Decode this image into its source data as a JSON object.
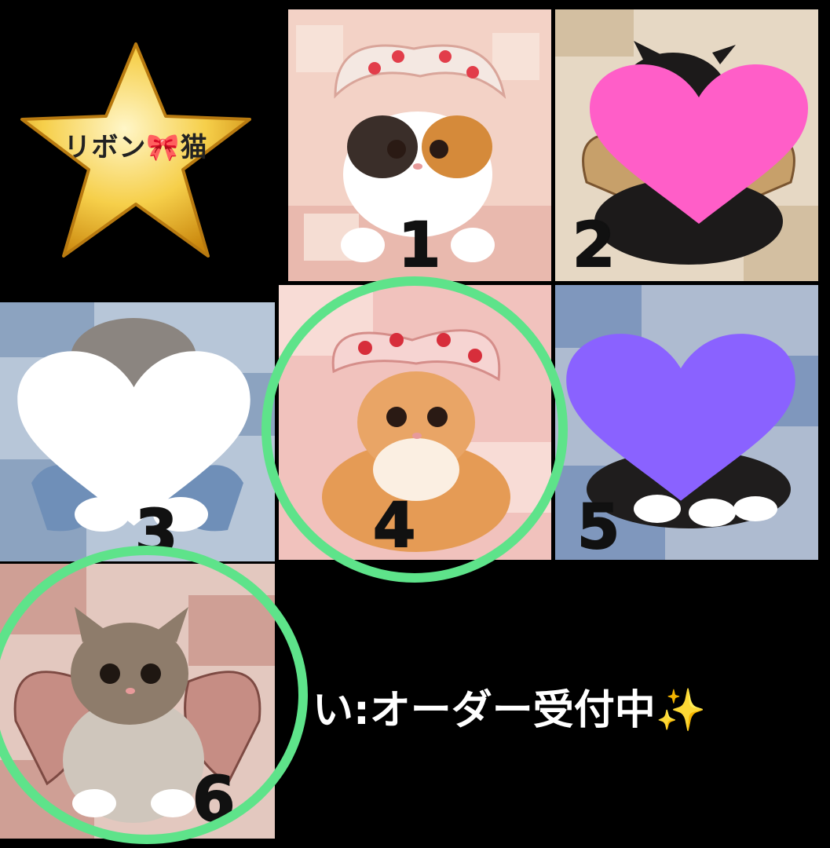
{
  "badge": {
    "text": "リボン🎀猫"
  },
  "tiles": [
    {
      "number": "1",
      "cat": "calico kitten with strawberry bow"
    },
    {
      "number": "2",
      "cat": "black kitten with leopard bow"
    },
    {
      "number": "3",
      "cat": "tabby kitten with denim bow"
    },
    {
      "number": "4",
      "cat": "orange kitten with strawberry bow"
    },
    {
      "number": "5",
      "cat": "black and white kitten with denim bow"
    },
    {
      "number": "6",
      "cat": "tabby kitten with gingham bow"
    }
  ],
  "hearts": {
    "tile2": "#ff5ec8",
    "tile3": "#ffffff",
    "tile5": "#8a62ff"
  },
  "highlight_color": "#5ee38a",
  "status": {
    "text": "い:オーダー受付中✨"
  }
}
